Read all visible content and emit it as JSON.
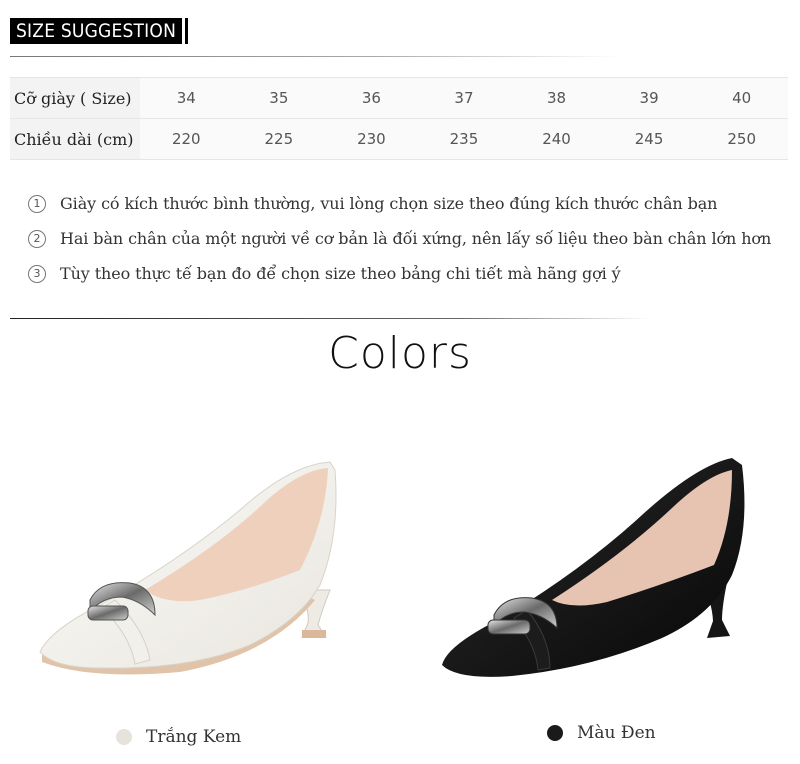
{
  "header": {
    "title": "SIZE SUGGESTION"
  },
  "size_table": {
    "rows": [
      {
        "label": "Cỡ giày ( Size)",
        "values": [
          "34",
          "35",
          "36",
          "37",
          "38",
          "39",
          "40"
        ]
      },
      {
        "label": "Chiều dài (cm)",
        "values": [
          "220",
          "225",
          "230",
          "235",
          "240",
          "245",
          "250"
        ]
      }
    ]
  },
  "notes": [
    {
      "marker": "1",
      "text": "Giày có kích thước bình thường, vui lòng chọn size theo đúng kích thước chân bạn"
    },
    {
      "marker": "2",
      "text": "Hai bàn chân của một người về cơ bản là đối xứng, nên lấy số liệu theo bàn chân lớn hơn"
    },
    {
      "marker": "3",
      "text": "Tùy theo thực tế bạn đo để chọn size theo bảng chi tiết mà hãng gợi ý"
    }
  ],
  "colors_section": {
    "title": "Colors",
    "options": [
      {
        "label": "Trắng Kem",
        "swatch": "#e6e2dc"
      },
      {
        "label": "Màu Đen",
        "swatch": "#1a1a1a"
      }
    ]
  }
}
